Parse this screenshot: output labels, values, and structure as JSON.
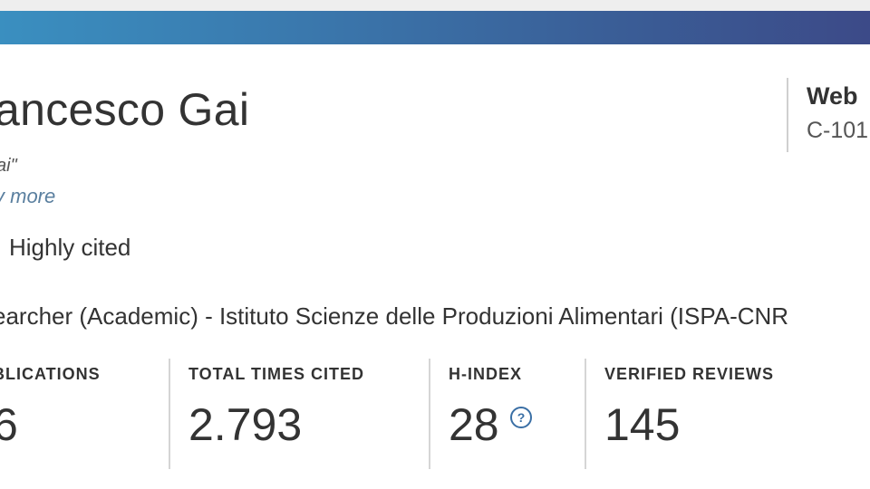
{
  "profile": {
    "name": "ancesco Gai",
    "alias": "ai\"",
    "view_more": "v more",
    "badge": "Highly cited",
    "affiliation": "earcher (Academic) - Istituto Scienze delle Produzioni Alimentari (ISPA-CNR"
  },
  "right_panel": {
    "title": "Web",
    "id": "C-101"
  },
  "metrics": [
    {
      "label": "BLICATIONS",
      "value": "6"
    },
    {
      "label": "TOTAL TIMES CITED",
      "value": "2.793"
    },
    {
      "label": "H-INDEX",
      "value": "28"
    },
    {
      "label": "VERIFIED REVIEWS",
      "value": "145"
    }
  ],
  "icons": {
    "help": "question-circle-icon",
    "help_glyph": "?"
  },
  "colors": {
    "header_gradient_start": "#3a8fc0",
    "header_gradient_end": "#3c4a88",
    "link": "#5a7f9f",
    "help_icon": "#3a6fa5"
  }
}
